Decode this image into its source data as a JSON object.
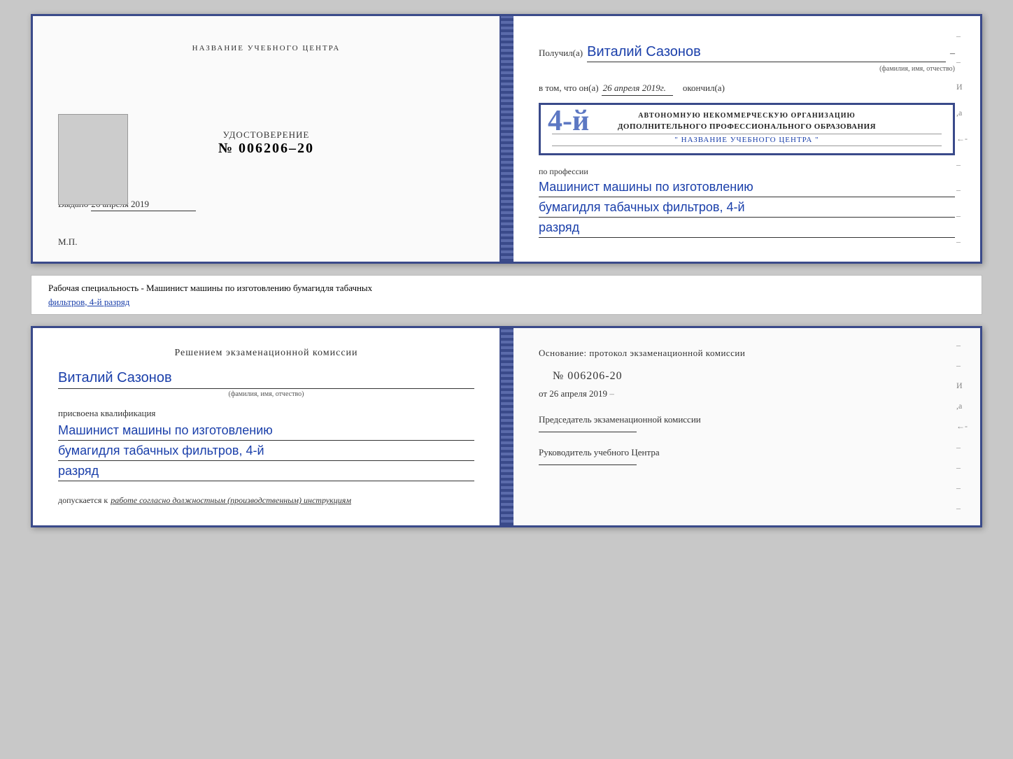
{
  "top_cert": {
    "left": {
      "title": "НАЗВАНИЕ УЧЕБНОГО ЦЕНТРА",
      "photo_alt": "Фото",
      "cert_label": "УДОСТОВЕРЕНИЕ",
      "cert_number": "№ 006206–20",
      "issued_label": "Выдано",
      "issued_date": "26 апреля 2019",
      "mp_label": "М.П."
    },
    "right": {
      "recipient_label": "Получил(а)",
      "recipient_name": "Виталий Сазонов",
      "recipient_sub": "(фамилия, имя, отчество)",
      "date_prefix": "в том, что он(а)",
      "date_value": "26 апреля 2019г.",
      "okonchil": "окончил(a)",
      "stamp_num": "4-й",
      "stamp_line1": "АВТОНОМНУЮ НЕКОММЕРЧЕСКУЮ ОРГАНИЗАЦИЮ",
      "stamp_line2": "ДОПОЛНИТЕЛЬНОГО ПРОФЕССИОНАЛЬНОГО ОБРАЗОВАНИЯ",
      "stamp_line3": "\" НАЗВАНИЕ УЧЕБНОГО ЦЕНТРА \"",
      "profession_label": "по профессии",
      "profession_line1": "Машинист машины по изготовлению",
      "profession_line2": "бумагидля табачных фильтров, 4-й",
      "profession_line3": "разряд"
    }
  },
  "label": {
    "text": "Рабочая специальность - Машинист машины по изготовлению бумагидля табачных",
    "underline_text": "фильтров, 4-й разряд"
  },
  "bottom_cert": {
    "left": {
      "decision_title": "Решением экзаменационной комиссии",
      "person_name": "Виталий Сазонов",
      "person_sub": "(фамилия, имя, отчество)",
      "qualification_label": "присвоена квалификация",
      "qualification_line1": "Машинист машины по изготовлению",
      "qualification_line2": "бумагидля табачных фильтров, 4-й",
      "qualification_line3": "разряд",
      "allows_label": "допускается к",
      "allows_value": "работе согласно должностным (производственным) инструкциям"
    },
    "right": {
      "basis_label": "Основание: протокол экзаменационной комиссии",
      "protocol_number": "№ 006206-20",
      "protocol_date_prefix": "от",
      "protocol_date": "26 апреля 2019",
      "chairman_label": "Председатель экзаменационной комиссии",
      "director_label": "Руководитель учебного Центра"
    }
  }
}
